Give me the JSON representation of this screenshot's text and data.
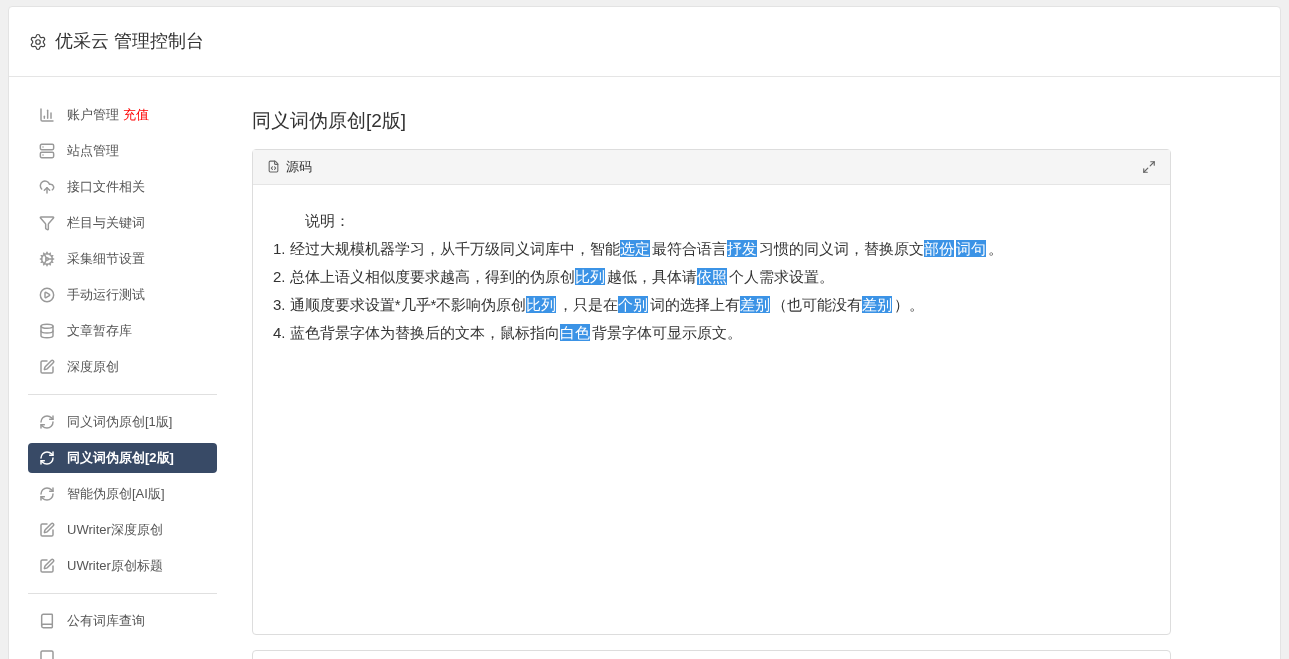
{
  "header": {
    "title": "优采云 管理控制台"
  },
  "sidebar": {
    "groups": [
      [
        {
          "label": "账户管理",
          "badge": "充值",
          "kind": "chart",
          "selected": false
        },
        {
          "label": "站点管理",
          "kind": "server",
          "selected": false
        },
        {
          "label": "接口文件相关",
          "kind": "cloud",
          "selected": false
        },
        {
          "label": "栏目与关键词",
          "kind": "filter",
          "selected": false
        },
        {
          "label": "采集细节设置",
          "kind": "gears",
          "selected": false
        },
        {
          "label": "手动运行测试",
          "kind": "play",
          "selected": false
        },
        {
          "label": "文章暂存库",
          "kind": "database",
          "selected": false
        },
        {
          "label": "深度原创",
          "kind": "edit",
          "selected": false
        }
      ],
      [
        {
          "label": "同义词伪原创[1版]",
          "kind": "refresh",
          "selected": false
        },
        {
          "label": "同义词伪原创[2版]",
          "kind": "refresh",
          "selected": true
        },
        {
          "label": "智能伪原创[AI版]",
          "kind": "refresh",
          "selected": false
        },
        {
          "label": "UWriter深度原创",
          "kind": "edit",
          "selected": false
        },
        {
          "label": "UWriter原创标题",
          "kind": "edit",
          "selected": false
        }
      ],
      [
        {
          "label": "公有词库查询",
          "kind": "book",
          "selected": false
        },
        {
          "kind": "square",
          "selected": false
        }
      ]
    ]
  },
  "main": {
    "title": "同义词伪原创[2版]",
    "panel": {
      "tab": "源码",
      "heading": "说明：",
      "lines": [
        [
          {
            "text": "1. 经过大规模机器学习，从千万级同义词库中，智能",
            "hl": false
          },
          {
            "text": "选定",
            "hl": true
          },
          {
            "text": "最符合语言",
            "hl": false
          },
          {
            "text": "抒发",
            "hl": true
          },
          {
            "text": "习惯的同义词，替换原文",
            "hl": false
          },
          {
            "text": "部份",
            "hl": true
          },
          {
            "text": "词句",
            "hl": true
          },
          {
            "text": "。",
            "hl": false
          }
        ],
        [
          {
            "text": "2. 总体上语义相似度要求越高，得到的伪原创",
            "hl": false
          },
          {
            "text": "比列",
            "hl": true
          },
          {
            "text": "越低，具体请",
            "hl": false
          },
          {
            "text": "依照",
            "hl": true
          },
          {
            "text": "个人需求设置。",
            "hl": false
          }
        ],
        [
          {
            "text": "3. 通顺度要求设置*几乎*不影响伪原创",
            "hl": false
          },
          {
            "text": "比列",
            "hl": true
          },
          {
            "text": "，只是在",
            "hl": false
          },
          {
            "text": "个别",
            "hl": true
          },
          {
            "text": "词的选择上有",
            "hl": false
          },
          {
            "text": "差别",
            "hl": true
          },
          {
            "text": "（也可能没有",
            "hl": false
          },
          {
            "text": "差别",
            "hl": true
          },
          {
            "text": "）。",
            "hl": false
          }
        ],
        [
          {
            "text": "4. 蓝色背景字体为替换后的文本，鼠标指向",
            "hl": false
          },
          {
            "text": "白色",
            "hl": true
          },
          {
            "text": "背景字体可显示原文。",
            "hl": false
          }
        ]
      ]
    }
  }
}
